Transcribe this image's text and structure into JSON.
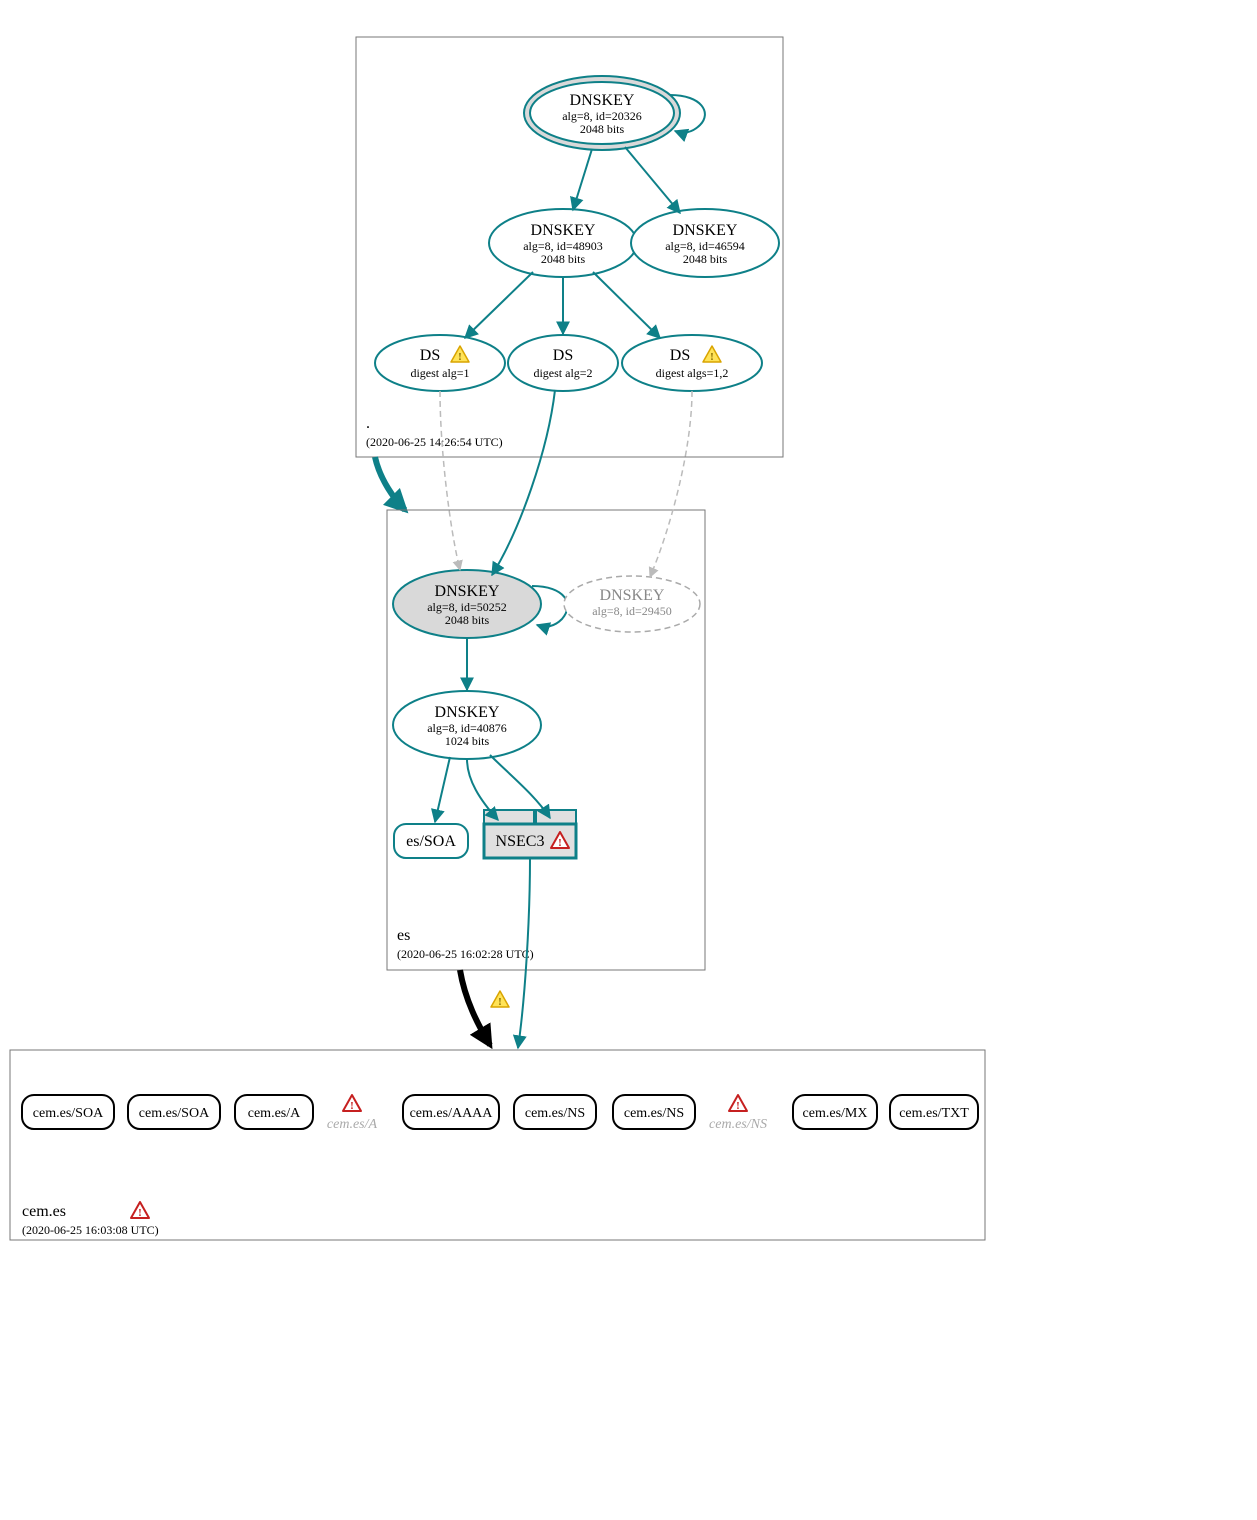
{
  "zones": {
    "root": {
      "label": ".",
      "timestamp": "(2020-06-25 14:26:54 UTC)"
    },
    "es": {
      "label": "es",
      "timestamp": "(2020-06-25 16:02:28 UTC)"
    },
    "cemes": {
      "label": "cem.es",
      "timestamp": "(2020-06-25 16:03:08 UTC)"
    }
  },
  "nodes": {
    "root_ksk": {
      "title": "DNSKEY",
      "l2": "alg=8, id=20326",
      "l3": "2048 bits"
    },
    "root_zsk1": {
      "title": "DNSKEY",
      "l2": "alg=8, id=48903",
      "l3": "2048 bits"
    },
    "root_zsk2": {
      "title": "DNSKEY",
      "l2": "alg=8, id=46594",
      "l3": "2048 bits"
    },
    "ds1": {
      "title": "DS",
      "l2": "digest alg=1"
    },
    "ds2": {
      "title": "DS",
      "l2": "digest alg=2"
    },
    "ds3": {
      "title": "DS",
      "l2": "digest algs=1,2"
    },
    "es_ksk": {
      "title": "DNSKEY",
      "l2": "alg=8, id=50252",
      "l3": "2048 bits"
    },
    "es_old": {
      "title": "DNSKEY",
      "l2": "alg=8, id=29450"
    },
    "es_zsk": {
      "title": "DNSKEY",
      "l2": "alg=8, id=40876",
      "l3": "1024 bits"
    },
    "es_soa": {
      "title": "es/SOA"
    },
    "nsec3": {
      "title": "NSEC3"
    },
    "cem_soa1": {
      "title": "cem.es/SOA"
    },
    "cem_soa2": {
      "title": "cem.es/SOA"
    },
    "cem_a1": {
      "title": "cem.es/A"
    },
    "cem_a2_faded": {
      "title": "cem.es/A"
    },
    "cem_aaaa": {
      "title": "cem.es/AAAA"
    },
    "cem_ns1": {
      "title": "cem.es/NS"
    },
    "cem_ns2": {
      "title": "cem.es/NS"
    },
    "cem_ns3_faded": {
      "title": "cem.es/NS"
    },
    "cem_mx": {
      "title": "cem.es/MX"
    },
    "cem_txt": {
      "title": "cem.es/TXT"
    }
  }
}
